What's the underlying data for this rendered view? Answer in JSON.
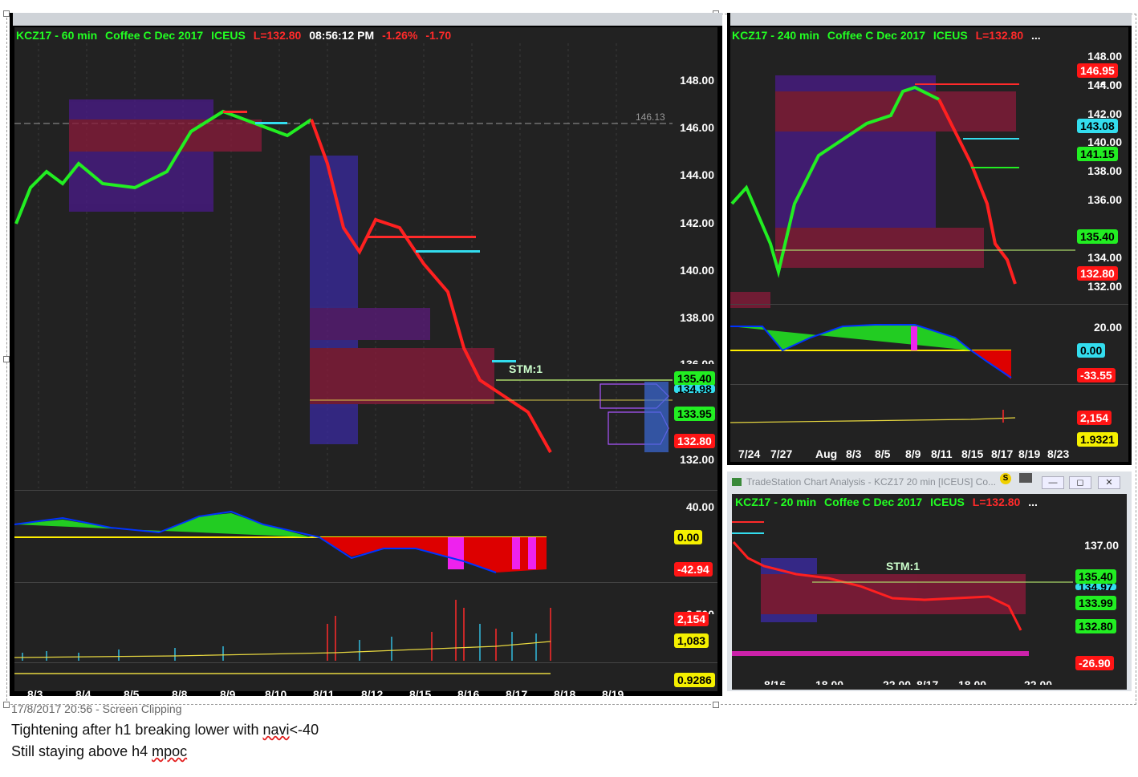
{
  "window1": {
    "symbol": "KCZ17 - 60 min",
    "instrument": "Coffee C Dec 2017",
    "exchange": "ICEUS",
    "last": "L=132.80",
    "time": "08:56:12 PM",
    "pct_change": "-1.26%",
    "net_change": "-1.70",
    "price_axis": [
      "148.00",
      "146.00",
      "144.00",
      "142.00",
      "140.00",
      "138.00",
      "136.00",
      "132.00"
    ],
    "ref_level": "146.13",
    "annotation": "STM:1",
    "price_labels": {
      "green1": "135.40",
      "cyan1": "134.98",
      "green2": "133.95",
      "red1": "132.80"
    },
    "osc_axis": "40.00",
    "osc_labels": {
      "zero": "0.00",
      "value": "-42.94"
    },
    "vol_axis": "2,500",
    "vol_labels": {
      "v1": "2,154",
      "v2": "1,083"
    },
    "ratio_label": "0.9286",
    "dates": [
      "8/3",
      "8/4",
      "8/5",
      "8/8",
      "8/9",
      "8/10",
      "8/11",
      "8/12",
      "8/15",
      "8/16",
      "8/17",
      "8/18",
      "8/19"
    ]
  },
  "window2": {
    "symbol": "KCZ17 - 240 min",
    "instrument": "Coffee C Dec 2017",
    "exchange": "ICEUS",
    "last": "L=132.80",
    "ellipsis": "...",
    "price_axis": [
      "148.00",
      "146.00",
      "144.00",
      "142.00",
      "140.00",
      "138.00",
      "136.00",
      "134.00",
      "132.00"
    ],
    "price_labels": {
      "red1": "146.95",
      "cyan1": "143.08",
      "green1": "141.15",
      "green2": "135.40",
      "red2": "132.80"
    },
    "osc_axis": "20.00",
    "osc_labels": {
      "zero": "0.00",
      "value": "-33.55"
    },
    "vol_labels": {
      "v1": "2,154",
      "ratio": "1.9321"
    },
    "dates": [
      "7/24",
      "7/27",
      "Aug",
      "8/3",
      "8/5",
      "8/9",
      "8/11",
      "8/15",
      "8/17",
      "8/19",
      "8/23"
    ]
  },
  "window3": {
    "title": "TradeStation Chart Analysis - KCZ17 20 min [ICEUS] Co...",
    "symbol": "KCZ17 - 20 min",
    "instrument": "Coffee C Dec 2017",
    "exchange": "ICEUS",
    "last": "L=132.80",
    "ellipsis": "...",
    "price_axis": [
      "137.00"
    ],
    "annotation": "STM:1",
    "price_labels": {
      "green1": "135.40",
      "cyan1": "134.97",
      "green2": "133.99",
      "green3": "132.80"
    },
    "osc_label": "-26.90",
    "dates": [
      "8/16",
      "18.00",
      "22.00",
      "8/17",
      "18.00",
      "22.00"
    ],
    "buttons": {
      "minimize": "—",
      "maximize": "◻",
      "close": "✕",
      "badge": "S"
    }
  },
  "clipping": {
    "timestamp": "17/8/2017 20:56 - Screen Clipping"
  },
  "notes": {
    "line1_before": "Tightening after h1 breaking lower with ",
    "line1_word": "navi",
    "line1_after": "<-40",
    "line2_before": "Still staying above h4 ",
    "line2_word": "mpoc"
  }
}
